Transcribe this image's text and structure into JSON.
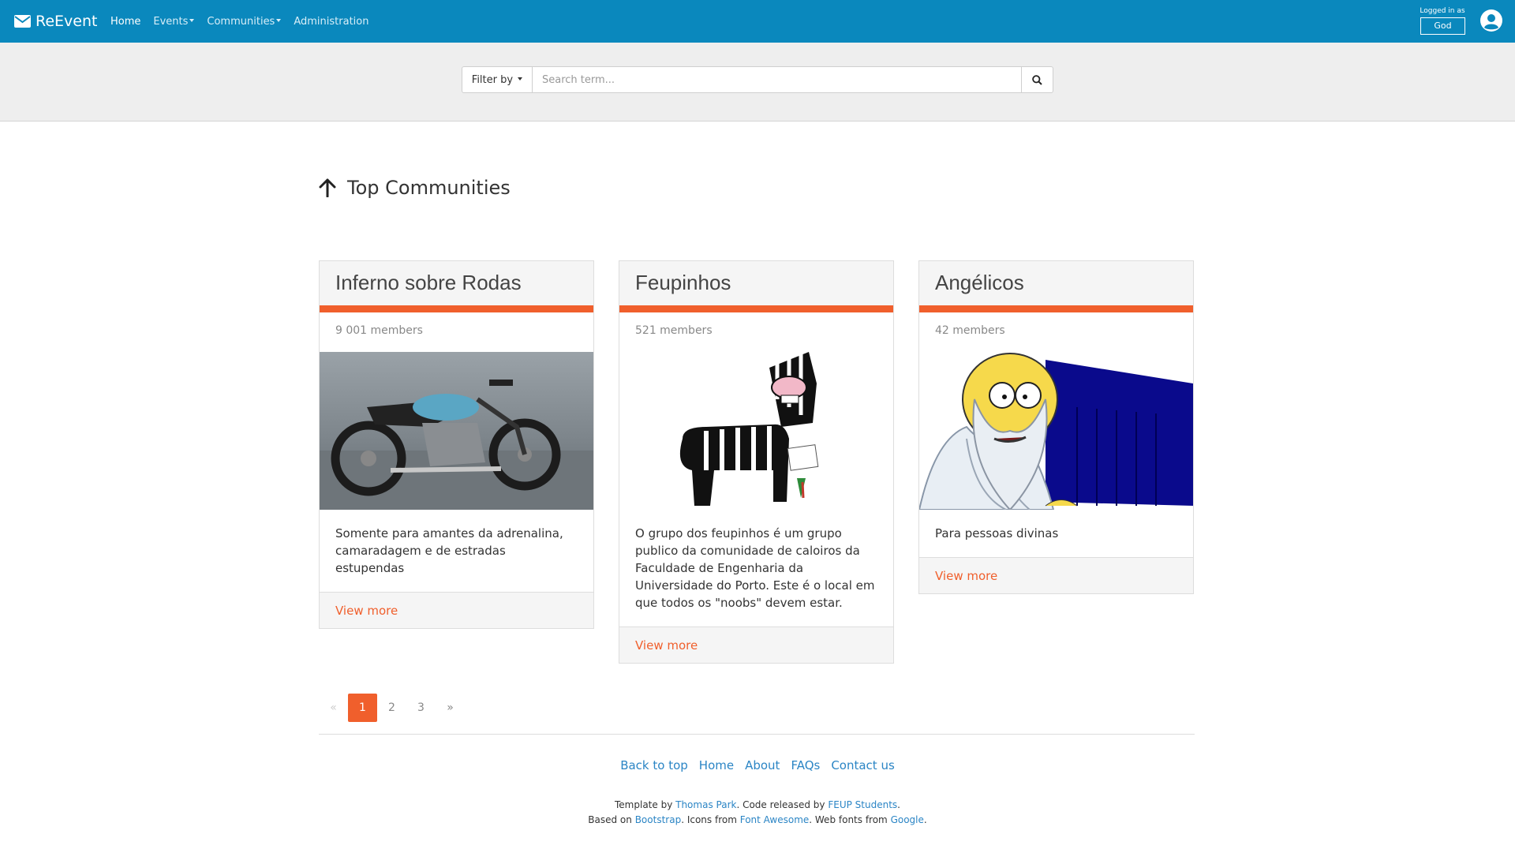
{
  "navbar": {
    "brand": "ReEvent",
    "items": [
      {
        "label": "Home",
        "active": true,
        "dropdown": false
      },
      {
        "label": "Events",
        "active": false,
        "dropdown": true
      },
      {
        "label": "Communities",
        "active": false,
        "dropdown": true
      },
      {
        "label": "Administration",
        "active": false,
        "dropdown": false
      }
    ],
    "logged_in_label": "Logged in as",
    "user": "God",
    "color": "#0a88bd"
  },
  "search": {
    "filter_label": "Filter by",
    "placeholder": "Search term..."
  },
  "section": {
    "title": "Top Communities"
  },
  "communities": [
    {
      "name": "Inferno sobre Rodas",
      "members": "9 001 members",
      "image": "motorcycle",
      "description": "Somente para amantes da adrenalina, camaradagem e de estradas estupendas",
      "link": "View more"
    },
    {
      "name": "Feupinhos",
      "members": "521 members",
      "image": "zebra-donkey-cartoon",
      "description": "O grupo dos feupinhos é um grupo publico da comunidade de caloiros da Faculdade de Engenharia da Universidade do Porto. Este é o local em que todos os \"noobs\" devem estar.",
      "link": "View more"
    },
    {
      "name": "Angélicos",
      "members": "42 members",
      "image": "god-cartoon",
      "description": "Para pessoas divinas",
      "link": "View more"
    }
  ],
  "pagination": {
    "prev": "«",
    "pages": [
      "1",
      "2",
      "3"
    ],
    "active": "1",
    "next": "»"
  },
  "footer": {
    "links": [
      "Back to top",
      "Home",
      "About",
      "FAQs",
      "Contact us"
    ],
    "line1": {
      "template_by": "Template by",
      "author": "Thomas Park",
      "code_released_by": ". Code released by",
      "students": "FEUP Students",
      "end": "."
    },
    "line2": {
      "based_on": "Based on",
      "bootstrap": "Bootstrap",
      "icons_from": ". Icons from",
      "fa": "Font Awesome",
      "webfonts_from": ". Web fonts from",
      "google": "Google",
      "end": "."
    }
  },
  "accent_color": "#f05f2c"
}
